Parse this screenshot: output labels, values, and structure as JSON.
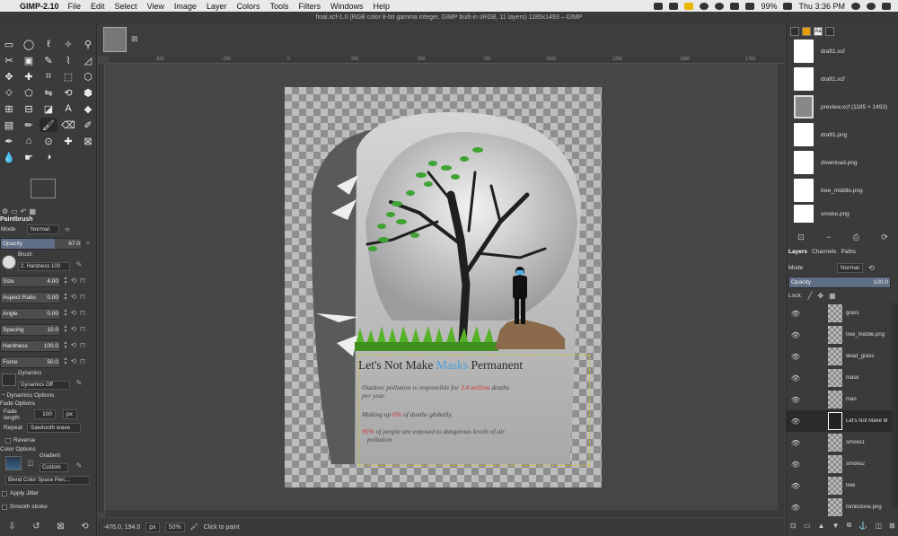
{
  "menubar": {
    "app_name": "GIMP-2.10",
    "items": [
      "File",
      "Edit",
      "Select",
      "View",
      "Image",
      "Layer",
      "Colors",
      "Tools",
      "Filters",
      "Windows",
      "Help"
    ],
    "battery": "99%",
    "clock": "Thu 3:36 PM"
  },
  "window_title": "final.xcf-1.0 (RGB color 8-bit gamma integer, GIMP built-in sRGB, 11 layers) 1185x1493 – GIMP",
  "tool_options": {
    "title": "Paintbrush",
    "mode_label": "Mode",
    "mode_value": "Normal",
    "opacity_label": "Opacity",
    "opacity_value": "67.0",
    "opacity_fraction": 0.67,
    "brush_label": "Brush",
    "brush_value": "2. Hardness 100",
    "size_label": "Size",
    "size_value": "4.00",
    "aspect_label": "Aspect Ratio",
    "aspect_value": "0.00",
    "angle_label": "Angle",
    "angle_value": "0.00",
    "spacing_label": "Spacing",
    "spacing_value": "10.0",
    "hardness_label": "Hardness",
    "hardness_value": "100.0",
    "force_label": "Force",
    "force_value": "50.0",
    "dynamics_label": "Dynamics",
    "dynamics_value": "Dynamics Off",
    "dynamics_options": "Dynamics Options",
    "fade_options": "Fade Options",
    "fade_length_label": "Fade length",
    "fade_length_value": "100",
    "fade_unit": "px",
    "repeat_label": "Repeat",
    "repeat_value": "Sawtooth wave",
    "reverse_label": "Reverse",
    "color_options": "Color Options",
    "gradient_label": "Gradient",
    "gradient_value": "Custom",
    "blend_value": "Blend Color Space Perc...",
    "apply_jitter": "Apply Jitter",
    "smooth_stroke": "Smooth stroke"
  },
  "canvas": {
    "ruler_ticks": [
      "-500",
      "-250",
      "0",
      "250",
      "500",
      "750",
      "1000",
      "1250",
      "1500",
      "1750"
    ],
    "poster": {
      "headline_part1": "Let's Not Make ",
      "headline_highlight": "Masks",
      "headline_part2": " Permanent",
      "line1_a": "Outdoor pollution is responsible for ",
      "line1_red": "3.4 million",
      "line1_b": " deaths",
      "line1_c": "per year.",
      "line2_a": "Making up ",
      "line2_red": "6%",
      "line2_b": " of deaths globally.",
      "line3_red": "95%",
      "line3_a": " of people are exposed to dangerous levels of air",
      "line3_b": "pollution."
    }
  },
  "statusbar": {
    "coords": "-476.0, 194.0",
    "unit": "px",
    "zoom": "50%",
    "hint": "Click to paint"
  },
  "documents": [
    {
      "name": "draft1.xcf",
      "thumb": "page"
    },
    {
      "name": "draft1.xcf",
      "thumb": "page"
    },
    {
      "name": "preview.xcf (1185 × 1493)",
      "thumb": "image"
    },
    {
      "name": "draft1.png",
      "thumb": "page"
    },
    {
      "name": "download.png",
      "thumb": "page"
    },
    {
      "name": "tree_middle.png",
      "thumb": "page"
    },
    {
      "name": "smoke.png",
      "thumb": "page"
    }
  ],
  "layers_panel": {
    "tabs": [
      "Layers",
      "Channels",
      "Paths"
    ],
    "mode_label": "Mode",
    "mode_value": "Normal",
    "opacity_label": "Opacity",
    "opacity_value": "100.0",
    "lock_label": "Lock:",
    "layers": [
      {
        "name": "grass",
        "selected": false,
        "text_layer": false
      },
      {
        "name": "tree_middle.png",
        "selected": false,
        "text_layer": false
      },
      {
        "name": "dead_grass",
        "selected": false,
        "text_layer": false
      },
      {
        "name": "mask",
        "selected": false,
        "text_layer": false
      },
      {
        "name": "man",
        "selected": false,
        "text_layer": false
      },
      {
        "name": "Let's Not Make M",
        "selected": true,
        "text_layer": true
      },
      {
        "name": "smoke1",
        "selected": false,
        "text_layer": false
      },
      {
        "name": "smoke2",
        "selected": false,
        "text_layer": false
      },
      {
        "name": "tree",
        "selected": false,
        "text_layer": false
      },
      {
        "name": "tombstone.png",
        "selected": false,
        "text_layer": false
      }
    ]
  }
}
